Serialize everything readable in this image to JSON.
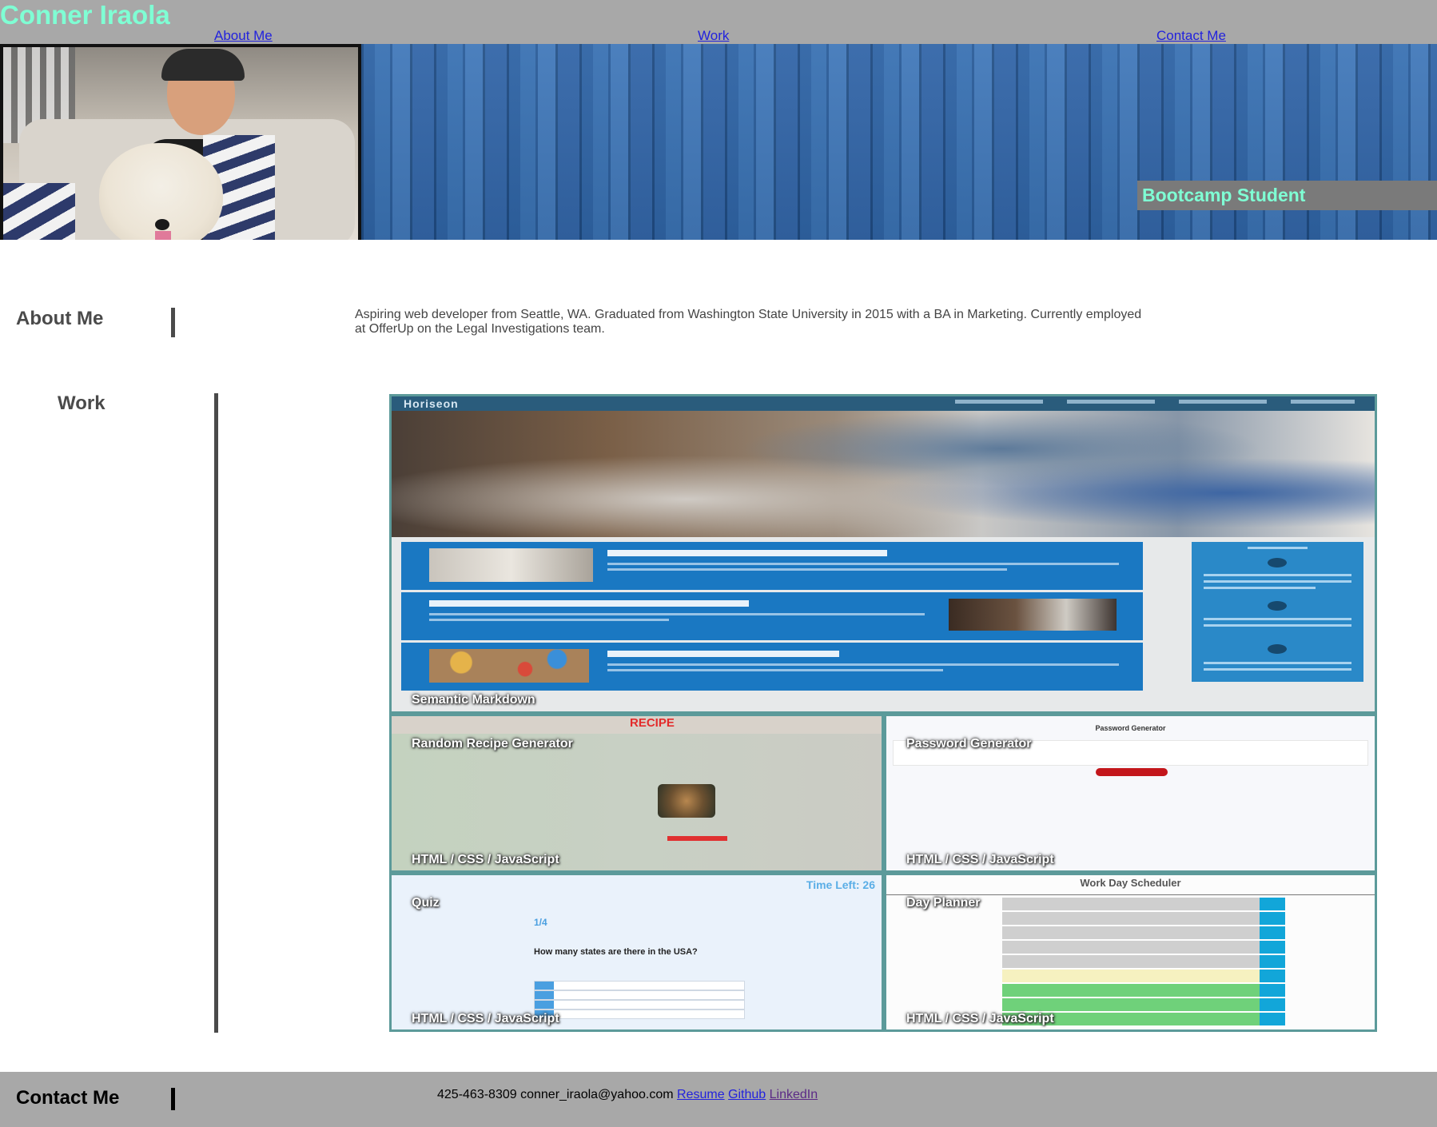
{
  "header": {
    "title": "Conner Iraola",
    "nav": [
      "About Me",
      "Work",
      "Contact Me"
    ]
  },
  "hero": {
    "tagline": "Bootcamp Student"
  },
  "about": {
    "heading": "About Me",
    "text": "Aspiring web developer from Seattle, WA. Graduated from Washington State University in 2015 with a BA in Marketing. Currently employed at OfferUp on the Legal Investigations team."
  },
  "work": {
    "heading": "Work",
    "projects": [
      {
        "title": "Semantic Markdown",
        "subtitle": ""
      },
      {
        "title": "Random Recipe Generator",
        "subtitle": "HTML / CSS / JavaScript"
      },
      {
        "title": "Password Generator",
        "subtitle": "HTML / CSS / JavaScript"
      },
      {
        "title": "Quiz",
        "subtitle": "HTML / CSS / JavaScript"
      },
      {
        "title": "Day Planner",
        "subtitle": "HTML / CSS / JavaScript"
      }
    ],
    "screens": {
      "horiseon_logo": "Horiseon",
      "recipe_word": "RECIPE",
      "password_heading": "Password Generator",
      "quiz_timer": "Time Left: 26",
      "quiz_number": "1/4",
      "quiz_question": "How many states are there in the USA?",
      "planner_title": "Work Day Scheduler"
    }
  },
  "contact": {
    "heading": "Contact Me",
    "phone": "425-463-8309",
    "email": "conner_iraola@yahoo.com",
    "links": [
      "Resume",
      "Github",
      "LinkedIn"
    ]
  },
  "colors": {
    "accent": "#7fffd4",
    "header_bg": "#a8a8a8",
    "card_border": "#5c9a9a",
    "link": "#2222dd"
  }
}
